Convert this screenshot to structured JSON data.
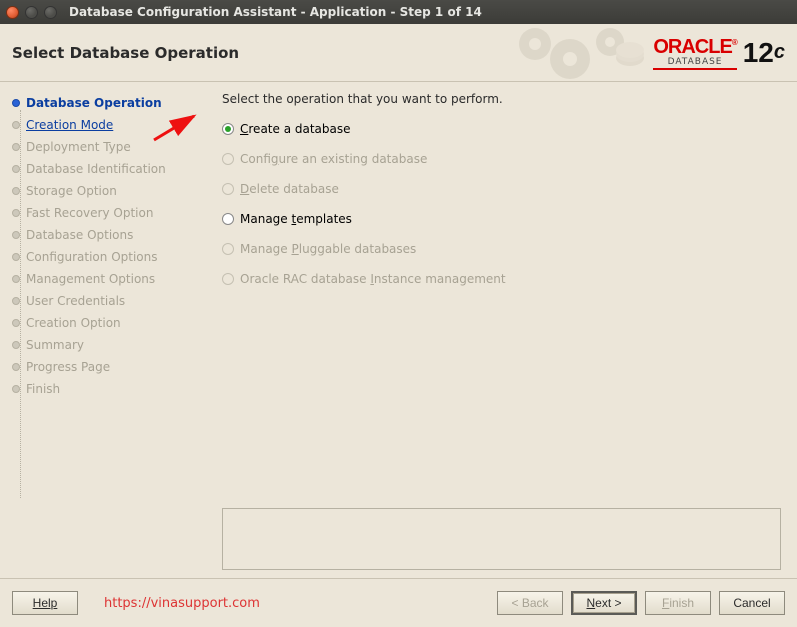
{
  "window": {
    "title": "Database Configuration Assistant - Application - Step 1 of 14"
  },
  "header": {
    "title": "Select Database Operation",
    "brand_oracle": "ORACLE",
    "brand_db": "DATABASE",
    "brand_version": "12",
    "brand_suffix": "c"
  },
  "sidebar": {
    "items": [
      {
        "label": "Database Operation",
        "state": "active"
      },
      {
        "label": "Creation Mode",
        "state": "sub"
      },
      {
        "label": "Deployment Type",
        "state": "inactive"
      },
      {
        "label": "Database Identification",
        "state": "inactive"
      },
      {
        "label": "Storage Option",
        "state": "inactive"
      },
      {
        "label": "Fast Recovery Option",
        "state": "inactive"
      },
      {
        "label": "Database Options",
        "state": "inactive"
      },
      {
        "label": "Configuration Options",
        "state": "inactive"
      },
      {
        "label": "Management Options",
        "state": "inactive"
      },
      {
        "label": "User Credentials",
        "state": "inactive"
      },
      {
        "label": "Creation Option",
        "state": "inactive"
      },
      {
        "label": "Summary",
        "state": "inactive"
      },
      {
        "label": "Progress Page",
        "state": "inactive"
      },
      {
        "label": "Finish",
        "state": "inactive"
      }
    ]
  },
  "content": {
    "instruction": "Select the operation that you want to perform.",
    "options": [
      {
        "pre": "",
        "m": "C",
        "post": "reate a database",
        "selected": true,
        "disabled": false
      },
      {
        "pre": "Confi",
        "m": "g",
        "post": "ure an existing database",
        "selected": false,
        "disabled": true
      },
      {
        "pre": "",
        "m": "D",
        "post": "elete database",
        "selected": false,
        "disabled": true
      },
      {
        "pre": "Manage ",
        "m": "t",
        "post": "emplates",
        "selected": false,
        "disabled": false
      },
      {
        "pre": "Manage ",
        "m": "P",
        "post": "luggable databases",
        "selected": false,
        "disabled": true
      },
      {
        "pre": "Oracle RAC database ",
        "m": "I",
        "post": "nstance management",
        "selected": false,
        "disabled": true
      }
    ]
  },
  "footer": {
    "help": "Help",
    "back": "< Back",
    "next_pre": "",
    "next_m": "N",
    "next_post": "ext >",
    "finish_pre": "",
    "finish_m": "F",
    "finish_post": "inish",
    "cancel": "Cancel",
    "watermark": "https://vinasupport.com"
  }
}
